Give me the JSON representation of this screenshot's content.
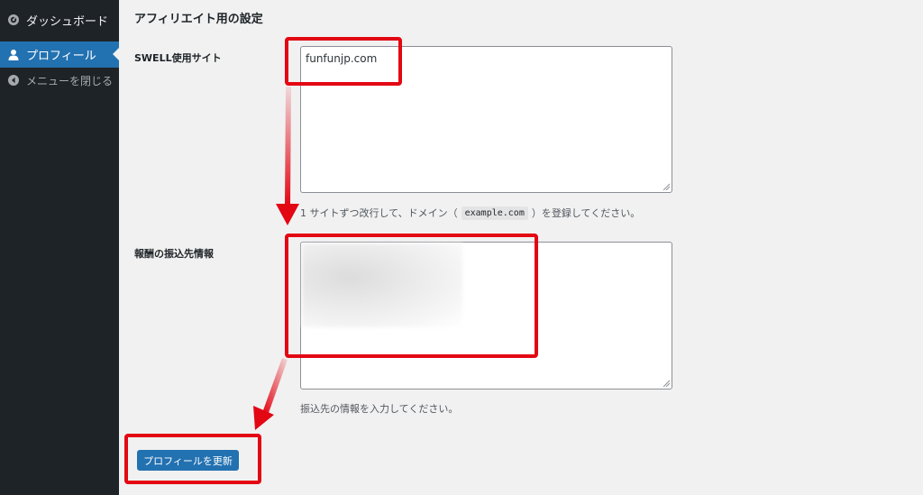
{
  "sidebar": {
    "items": [
      {
        "label": "ダッシュボード",
        "icon": "dashboard-icon"
      },
      {
        "label": "プロフィール",
        "icon": "user-icon"
      },
      {
        "label": "メニューを閉じる",
        "icon": "collapse-icon"
      }
    ]
  },
  "main": {
    "section_title": "アフィリエイト用の設定",
    "swell_site": {
      "label": "SWELL使用サイト",
      "value": "funfunjp.com",
      "description_before": "1 サイトずつ改行して、ドメイン（",
      "description_code": "example.com",
      "description_after": "）を登録してください。"
    },
    "payment_info": {
      "label": "報酬の振込先情報",
      "value_state": "blurred",
      "description": "振込先の情報を入力してください。"
    },
    "update_button": "プロフィールを更新"
  },
  "colors": {
    "sidebar_bg": "#1d2327",
    "accent": "#2271b1",
    "highlight": "#e30613",
    "content_bg": "#f1f1f1"
  }
}
